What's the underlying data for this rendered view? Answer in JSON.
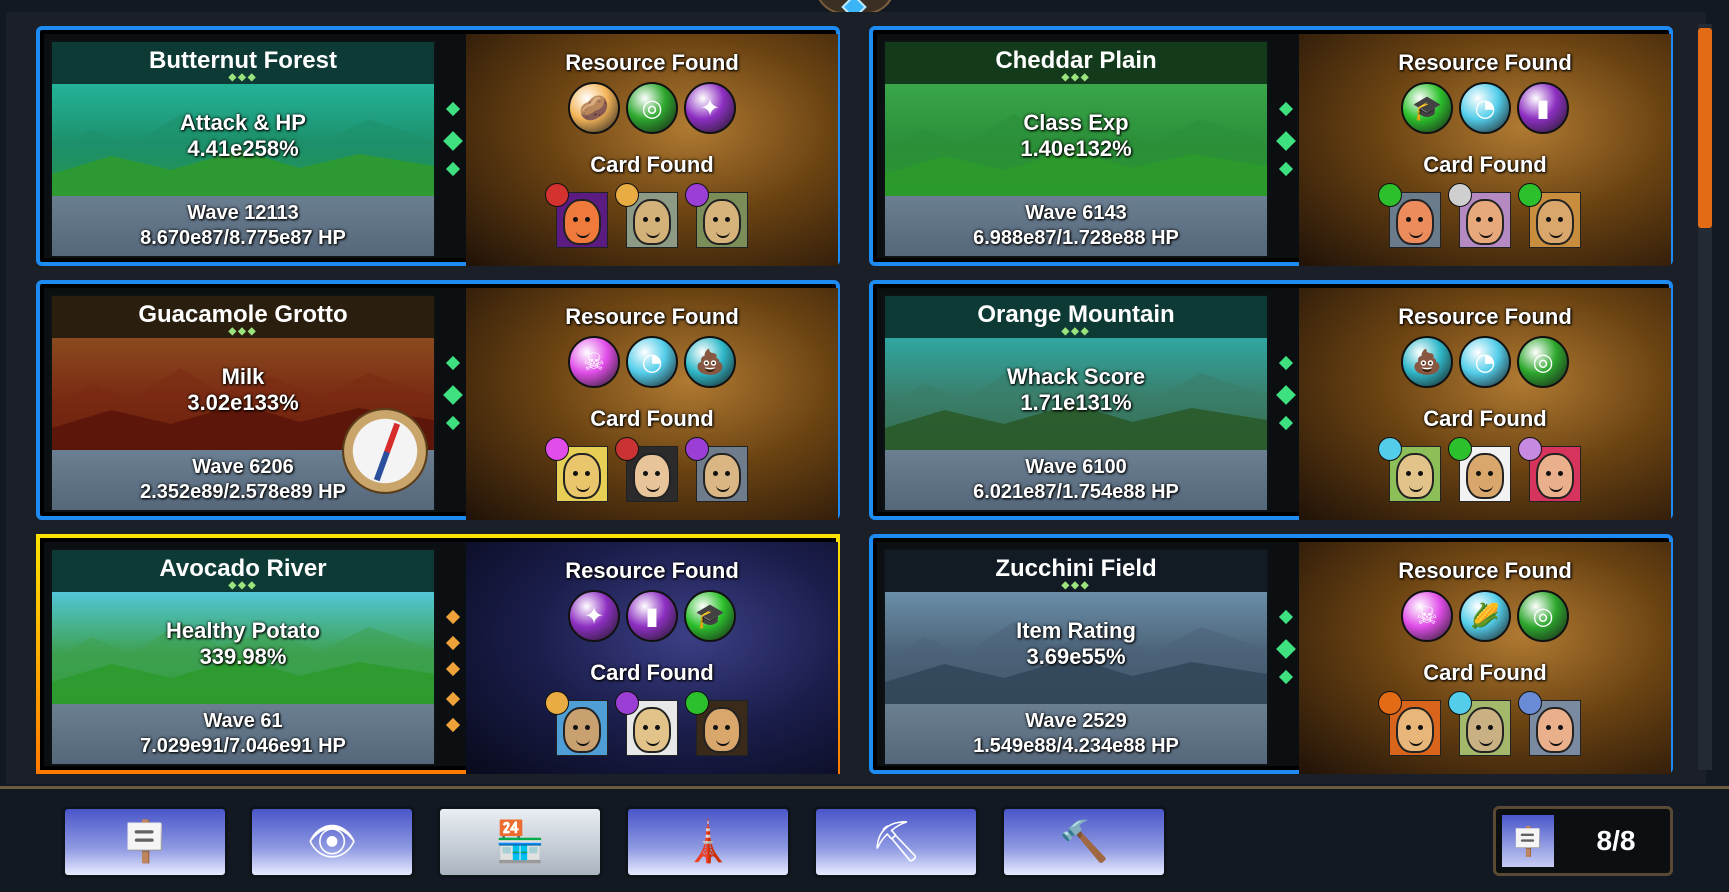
{
  "worlds": [
    {
      "name": "Butternut Forest",
      "bonus_name": "Attack & HP",
      "bonus_value": "4.41e258%",
      "wave": "Wave 12113",
      "hp": "8.670e87/8.775e87 HP",
      "resource_heading": "Resource Found",
      "card_heading": "Card Found",
      "theme": "forest-teal",
      "resources": [
        {
          "icon": "potato-icon",
          "color": "#f3b458",
          "glyph": "🥔"
        },
        {
          "icon": "hay-bale-icon",
          "color": "#2da72d",
          "glyph": "◎"
        },
        {
          "icon": "crystal-orb-icon",
          "color": "#8d2fc2",
          "glyph": "✦"
        }
      ],
      "cards": [
        {
          "badge": "heart",
          "badge_color": "#d4322f",
          "skin": "#f07a3c",
          "bg": "#5b1b80"
        },
        {
          "badge": "potato",
          "badge_color": "#e9ac42",
          "skin": "#d3b27a",
          "bg": "#8d9a86"
        },
        {
          "badge": "orb",
          "badge_color": "#9a3ed6",
          "skin": "#d6b37b",
          "bg": "#7b8e59"
        }
      ]
    },
    {
      "name": "Cheddar Plain",
      "bonus_name": "Class Exp",
      "bonus_value": "1.40e132%",
      "wave": "Wave 6143",
      "hp": "6.988e87/1.728e88 HP",
      "resource_heading": "Resource Found",
      "card_heading": "Card Found",
      "theme": "plain-green",
      "resources": [
        {
          "icon": "graduation-cap-icon",
          "color": "#2cc12c",
          "glyph": "🎓"
        },
        {
          "icon": "brain-icon",
          "color": "#53cdea",
          "glyph": "◔"
        },
        {
          "icon": "milk-bottle-icon",
          "color": "#8d2fc2",
          "glyph": "▮"
        }
      ],
      "cards": [
        {
          "badge": "cap",
          "badge_color": "#2cc12c",
          "skin": "#ec8b5c",
          "bg": "#6a7b8c"
        },
        {
          "badge": "cap",
          "badge_color": "#cfcfcf",
          "skin": "#e7a97b",
          "bg": "#b58ac2"
        },
        {
          "badge": "jar",
          "badge_color": "#2cc12c",
          "skin": "#d9a66c",
          "bg": "#c98d3e"
        }
      ]
    },
    {
      "name": "Guacamole Grotto",
      "bonus_name": "Milk",
      "bonus_value": "3.02e133%",
      "wave": "Wave 6206",
      "hp": "2.352e89/2.578e89 HP",
      "resource_heading": "Resource Found",
      "card_heading": "Card Found",
      "theme": "grotto-red",
      "resources": [
        {
          "icon": "skull-icon",
          "color": "#e04de8",
          "glyph": "☠"
        },
        {
          "icon": "brain-icon",
          "color": "#53cdea",
          "glyph": "◔"
        },
        {
          "icon": "poop-icon",
          "color": "#2fb8c9",
          "glyph": "💩"
        }
      ],
      "cards": [
        {
          "badge": "skull",
          "badge_color": "#e04de8",
          "skin": "#e9c56b",
          "bg": "#e7cf56"
        },
        {
          "badge": "bomb",
          "badge_color": "#c93333",
          "skin": "#e8c49a",
          "bg": "#2b2b2b"
        },
        {
          "badge": "chest",
          "badge_color": "#9a3ed6",
          "skin": "#d9b684",
          "bg": "#6f7c8c"
        }
      ]
    },
    {
      "name": "Orange Mountain",
      "bonus_name": "Whack Score",
      "bonus_value": "1.71e131%",
      "wave": "Wave 6100",
      "hp": "6.021e87/1.754e88 HP",
      "resource_heading": "Resource Found",
      "card_heading": "Card Found",
      "theme": "mountain-teal",
      "resources": [
        {
          "icon": "poop-icon",
          "color": "#2fb8c9",
          "glyph": "💩"
        },
        {
          "icon": "brain-icon",
          "color": "#53cdea",
          "glyph": "◔"
        },
        {
          "icon": "hay-bale-icon",
          "color": "#2da72d",
          "glyph": "◎"
        }
      ],
      "cards": [
        {
          "badge": "corn",
          "badge_color": "#53cdea",
          "skin": "#e2c48a",
          "bg": "#8dbf59"
        },
        {
          "badge": "cap",
          "badge_color": "#2cc12c",
          "skin": "#d9a66c",
          "bg": "#f2f2f2"
        },
        {
          "badge": "gem",
          "badge_color": "#c78ae0",
          "skin": "#eab08c",
          "bg": "#d6345c"
        }
      ]
    },
    {
      "name": "Avocado River",
      "bonus_name": "Healthy Potato",
      "bonus_value": "339.98%",
      "wave": "Wave 61",
      "hp": "7.029e91/7.046e91 HP",
      "resource_heading": "Resource Found",
      "card_heading": "Card Found",
      "theme": "river-teal",
      "selected": true,
      "resources": [
        {
          "icon": "crystal-orb-icon",
          "color": "#8d2fc2",
          "glyph": "✦"
        },
        {
          "icon": "milk-bottle-icon",
          "color": "#8d2fc2",
          "glyph": "▮"
        },
        {
          "icon": "graduation-cap-icon",
          "color": "#2cc12c",
          "glyph": "🎓"
        }
      ],
      "cards": [
        {
          "badge": "leaf",
          "badge_color": "#e9ac42",
          "skin": "#c9a070",
          "bg": "#4f9fd6"
        },
        {
          "badge": "milk",
          "badge_color": "#9a3ed6",
          "skin": "#e2c48a",
          "bg": "#e8e8e8"
        },
        {
          "badge": "jar",
          "badge_color": "#2cc12c",
          "skin": "#d9a66c",
          "bg": "#3a2a1a"
        }
      ]
    },
    {
      "name": "Zucchini Field",
      "bonus_name": "Item Rating",
      "bonus_value": "3.69e55%",
      "wave": "Wave 2529",
      "hp": "1.549e88/4.234e88 HP",
      "resource_heading": "Resource Found",
      "card_heading": "Card Found",
      "theme": "field-grey",
      "resources": [
        {
          "icon": "skull-icon",
          "color": "#e04de8",
          "glyph": "☠"
        },
        {
          "icon": "corn-icon",
          "color": "#53cdea",
          "glyph": "🌽"
        },
        {
          "icon": "hay-bale-icon",
          "color": "#2da72d",
          "glyph": "◎"
        }
      ],
      "cards": [
        {
          "badge": "sun",
          "badge_color": "#e36b15",
          "skin": "#e7b678",
          "bg": "#d9641c"
        },
        {
          "badge": "feather",
          "badge_color": "#53cdea",
          "skin": "#c9b184",
          "bg": "#a3b86a"
        },
        {
          "badge": "pill",
          "badge_color": "#6a8bd6",
          "skin": "#eab08c",
          "bg": "#7a8aa0"
        }
      ]
    }
  ],
  "nav": [
    {
      "name": "signpost",
      "glyph": "🪧"
    },
    {
      "name": "eye-signpost",
      "glyph": "👁"
    },
    {
      "name": "shop",
      "glyph": "🏪",
      "active": true
    },
    {
      "name": "tower",
      "glyph": "🗼"
    },
    {
      "name": "pickaxe-shovel",
      "glyph": "⛏"
    },
    {
      "name": "hammer",
      "glyph": "🔨"
    }
  ],
  "counter": {
    "value": "8/8",
    "glyph": "🪧"
  },
  "themes": {
    "forest-teal": {
      "sky": "#23b399",
      "mid": "#1d8f6a",
      "ground": "#2f9a2f",
      "title": "#0e3a36"
    },
    "plain-green": {
      "sky": "#3aa64a",
      "mid": "#2b8f39",
      "ground": "#2b9a2b",
      "title": "#123a1b"
    },
    "grotto-red": {
      "sky": "#8a4a1f",
      "mid": "#7a2a12",
      "ground": "#5a150a",
      "title": "#2a1e0f"
    },
    "mountain-teal": {
      "sky": "#2fa6a0",
      "mid": "#3b7d6a",
      "ground": "#2a5a2a",
      "title": "#0e3a36"
    },
    "river-teal": {
      "sky": "#52c6d7",
      "mid": "#3ea150",
      "ground": "#2c9a2c",
      "title": "#0e3a36"
    },
    "field-grey": {
      "sky": "#6a8ea8",
      "mid": "#4c6378",
      "ground": "#33475a",
      "title": "#121a24"
    }
  }
}
